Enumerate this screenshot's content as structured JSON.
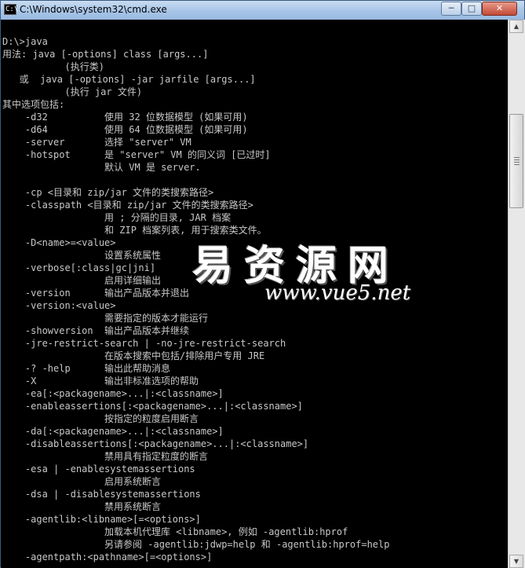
{
  "window": {
    "title": "C:\\Windows\\system32\\cmd.exe",
    "icon_label": "C:\\",
    "minimize_label": "─",
    "maximize_label": "□",
    "close_label": "✕"
  },
  "console": {
    "lines": [
      "",
      "D:\\>java",
      "用法: java [-options] class [args...]",
      "           (执行类)",
      "   或  java [-options] -jar jarfile [args...]",
      "           (执行 jar 文件)",
      "其中选项包括:",
      "    -d32          使用 32 位数据模型 (如果可用)",
      "    -d64          使用 64 位数据模型 (如果可用)",
      "    -server       选择 \"server\" VM",
      "    -hotspot      是 \"server\" VM 的同义词 [已过时]",
      "                  默认 VM 是 server.",
      "",
      "    -cp <目录和 zip/jar 文件的类搜索路径>",
      "    -classpath <目录和 zip/jar 文件的类搜索路径>",
      "                  用 ; 分隔的目录, JAR 档案",
      "                  和 ZIP 档案列表, 用于搜索类文件。",
      "    -D<name>=<value>",
      "                  设置系统属性",
      "    -verbose[:class|gc|jni]",
      "                  启用详细输出",
      "    -version      输出产品版本并退出",
      "    -version:<value>",
      "                  需要指定的版本才能运行",
      "    -showversion  输出产品版本并继续",
      "    -jre-restrict-search | -no-jre-restrict-search",
      "                  在版本搜索中包括/排除用户专用 JRE",
      "    -? -help      输出此帮助消息",
      "    -X            输出非标准选项的帮助",
      "    -ea[:<packagename>...|:<classname>]",
      "    -enableassertions[:<packagename>...|:<classname>]",
      "                  按指定的粒度启用断言",
      "    -da[:<packagename>...|:<classname>]",
      "    -disableassertions[:<packagename>...|:<classname>]",
      "                  禁用具有指定粒度的断言",
      "    -esa | -enablesystemassertions",
      "                  启用系统断言",
      "    -dsa | -disablesystemassertions",
      "                  禁用系统断言",
      "    -agentlib:<libname>[=<options>]",
      "                  加载本机代理库 <libname>, 例如 -agentlib:hprof",
      "                  另请参阅 -agentlib:jdwp=help 和 -agentlib:hprof=help",
      "    -agentpath:<pathname>[=<options>]"
    ]
  },
  "scrollbar": {
    "up_arrow": "▲",
    "down_arrow": "▼",
    "position": 0.19
  },
  "watermark": {
    "chinese": "易资源网",
    "url": "www.vue5.net"
  }
}
